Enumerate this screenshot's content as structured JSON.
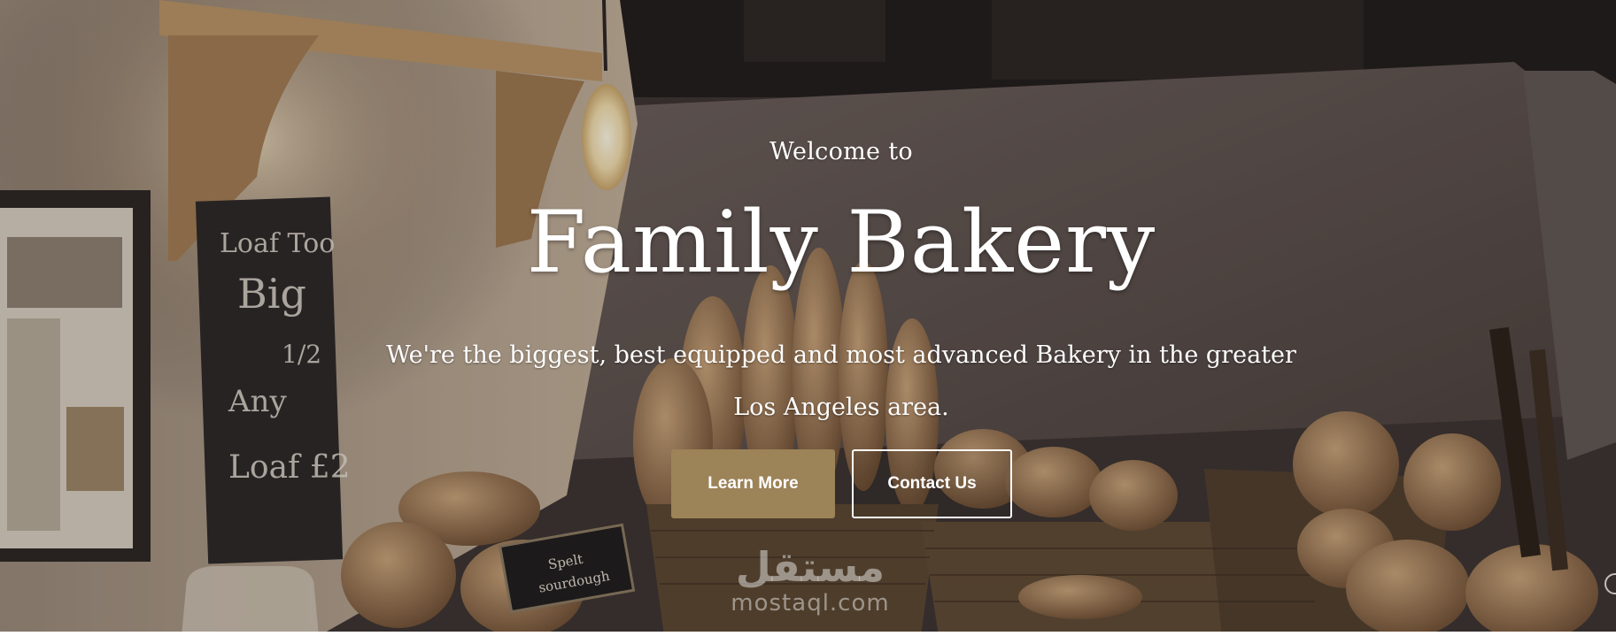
{
  "hero": {
    "welcome": "Welcome to",
    "title": "Family Bakery",
    "tagline": "We're the biggest, best equipped and most advanced Bakery in the greater Los Angeles area."
  },
  "buttons": {
    "learn_more": "Learn More",
    "contact_us": "Contact Us"
  },
  "scene": {
    "chalkboard_text": [
      "Loaf Too",
      "Big",
      "1/2",
      "Any",
      "Loaf £2"
    ],
    "sign_text": [
      "Spelt",
      "sourdough"
    ]
  },
  "watermark": {
    "logo": "مستقل",
    "text": "mostaql.com"
  },
  "colors": {
    "primary_button": "#9c8358",
    "text": "#ffffff"
  }
}
